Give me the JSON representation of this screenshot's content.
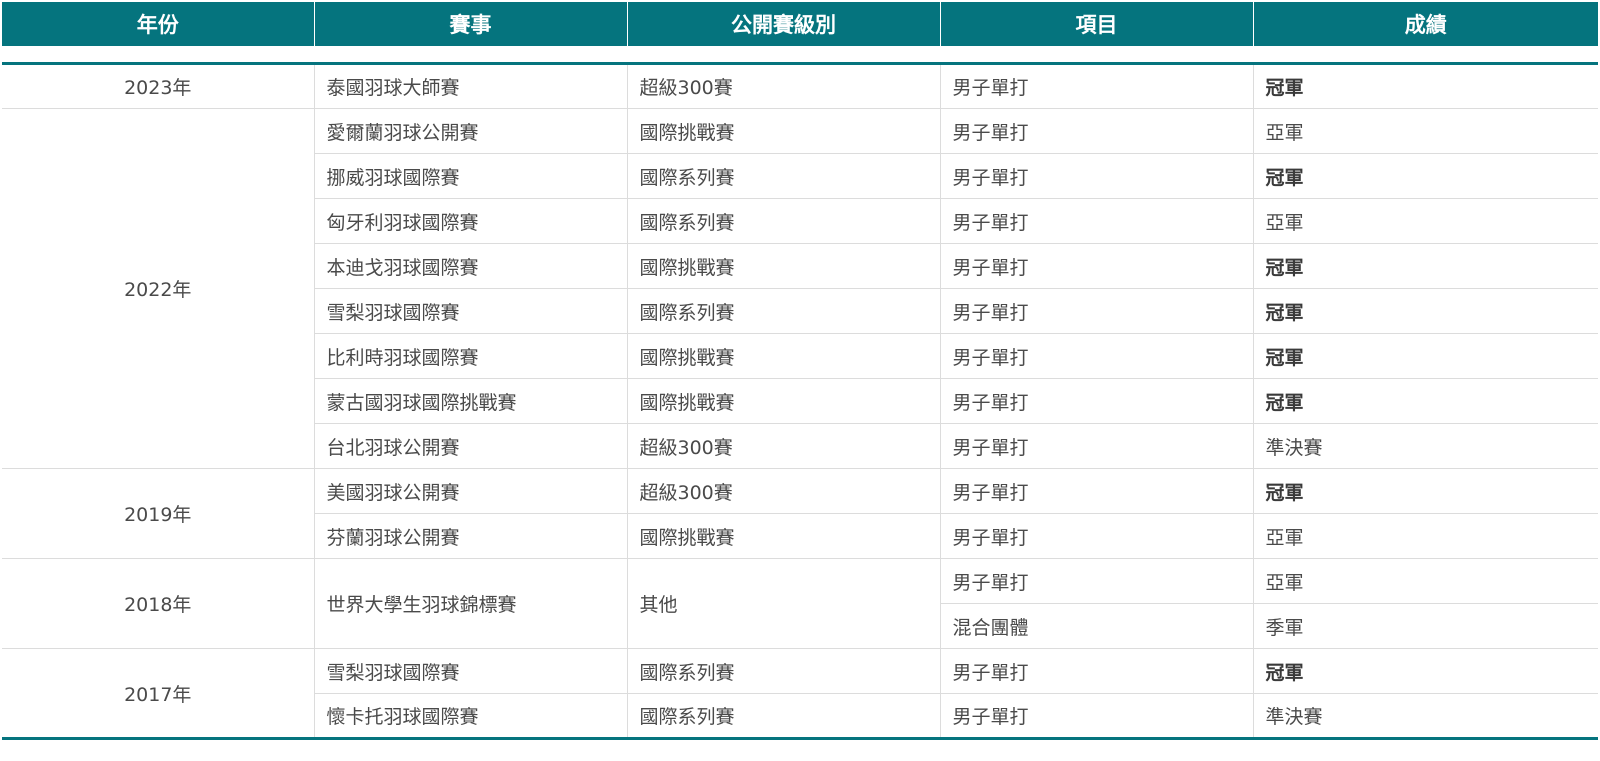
{
  "headers": [
    "年份",
    "賽事",
    "公開賽級別",
    "項目",
    "成績"
  ],
  "rows": [
    {
      "year": "2023年",
      "event": "泰國羽球大師賽",
      "level": "超級300賽",
      "item": "男子單打",
      "result": "冠軍"
    },
    {
      "year": "2022年",
      "event": "愛爾蘭羽球公開賽",
      "level": "國際挑戰賽",
      "item": "男子單打",
      "result": "亞軍"
    },
    {
      "event": "挪威羽球國際賽",
      "level": "國際系列賽",
      "item": "男子單打",
      "result": "冠軍"
    },
    {
      "event": "匈牙利羽球國際賽",
      "level": "國際系列賽",
      "item": "男子單打",
      "result": "亞軍"
    },
    {
      "event": "本迪戈羽球國際賽",
      "level": "國際挑戰賽",
      "item": "男子單打",
      "result": "冠軍"
    },
    {
      "event": "雪梨羽球國際賽",
      "level": "國際系列賽",
      "item": "男子單打",
      "result": "冠軍"
    },
    {
      "event": "比利時羽球國際賽",
      "level": "國際挑戰賽",
      "item": "男子單打",
      "result": "冠軍"
    },
    {
      "event": "蒙古國羽球國際挑戰賽",
      "level": "國際挑戰賽",
      "item": "男子單打",
      "result": "冠軍"
    },
    {
      "event": "台北羽球公開賽",
      "level": "超級300賽",
      "item": "男子單打",
      "result": "準決賽"
    },
    {
      "year": "2019年",
      "event": "美國羽球公開賽",
      "level": "超級300賽",
      "item": "男子單打",
      "result": "冠軍"
    },
    {
      "event": "芬蘭羽球公開賽",
      "level": "國際挑戰賽",
      "item": "男子單打",
      "result": "亞軍"
    },
    {
      "year": "2018年",
      "event": "世界大學生羽球錦標賽",
      "level": "其他",
      "item": "男子單打",
      "result": "亞軍"
    },
    {
      "item": "混合團體",
      "result": "季軍"
    },
    {
      "year": "2017年",
      "event": "雪梨羽球國際賽",
      "level": "國際系列賽",
      "item": "男子單打",
      "result": "冠軍"
    },
    {
      "event": "懷卡托羽球國際賽",
      "level": "國際系列賽",
      "item": "男子單打",
      "result": "準決賽"
    }
  ],
  "colors": {
    "header_bg": "#05747e",
    "rule": "#05747e",
    "grid": "#dcdcdc"
  }
}
